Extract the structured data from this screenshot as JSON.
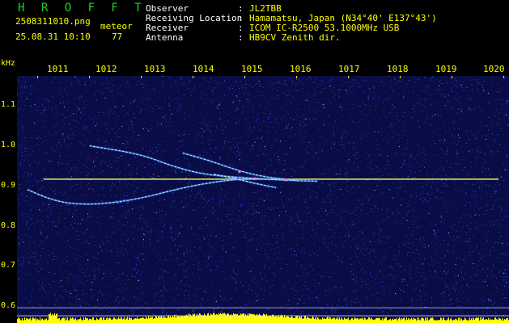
{
  "app": {
    "title": "H R O F F T"
  },
  "file": {
    "name": "2508311010.png",
    "timestamp": "25.08.31 10:10",
    "mode_label": "meteor",
    "count": "77"
  },
  "station": {
    "labels": [
      "Observer",
      "Receiving Location",
      "Receiver",
      "Antenna"
    ],
    "values": [
      "JL2TBB",
      "Hamamatsu, Japan (N34°40' E137°43')",
      "ICOM IC-R2500 53.1000MHz USB",
      "HB9CV Zenith dir."
    ],
    "separator": ":"
  },
  "axis": {
    "x_ticks": [
      "1011",
      "1012",
      "1013",
      "1014",
      "1015",
      "1016",
      "1017",
      "1018",
      "1019",
      "1020"
    ],
    "y_unit": "kHz",
    "y_ticks": [
      "1.1",
      "1.0",
      "0.9",
      "0.8",
      "0.7",
      "0.6"
    ]
  },
  "colors": {
    "title": "#1fd41f",
    "text": "#ffff00",
    "labels": "#ffffff",
    "background": "#0a0c46",
    "carrier": "#e8f060",
    "noise_floor": "#22c8e8",
    "bar": "#ffff00"
  },
  "chart_data": {
    "type": "heatmap",
    "xlabel": "",
    "ylabel": "kHz",
    "x_range": [
      1010.6,
      1020.1
    ],
    "y_range": [
      0.585,
      1.2
    ],
    "carrier_hz": 0.943,
    "reference_lines": [
      0.623,
      0.603
    ],
    "echoes": [
      {
        "points": [
          [
            1012.0,
            1.026
          ],
          [
            1013.0,
            1.005
          ],
          [
            1013.6,
            0.975
          ],
          [
            1014.2,
            0.955
          ],
          [
            1014.8,
            0.948
          ],
          [
            1015.8,
            0.94
          ],
          [
            1016.4,
            0.938
          ]
        ]
      },
      {
        "points": [
          [
            1013.8,
            1.008
          ],
          [
            1014.3,
            0.99
          ],
          [
            1014.9,
            0.963
          ],
          [
            1015.4,
            0.948
          ],
          [
            1016.0,
            0.94
          ]
        ]
      },
      {
        "points": [
          [
            1010.8,
            0.917
          ],
          [
            1011.2,
            0.895
          ],
          [
            1011.6,
            0.882
          ],
          [
            1012.2,
            0.88
          ],
          [
            1013.0,
            0.895
          ],
          [
            1013.8,
            0.922
          ],
          [
            1014.6,
            0.94
          ],
          [
            1015.2,
            0.945
          ]
        ]
      },
      {
        "points": [
          [
            1014.4,
            0.955
          ],
          [
            1014.8,
            0.945
          ],
          [
            1015.2,
            0.932
          ],
          [
            1015.6,
            0.922
          ]
        ]
      }
    ]
  }
}
